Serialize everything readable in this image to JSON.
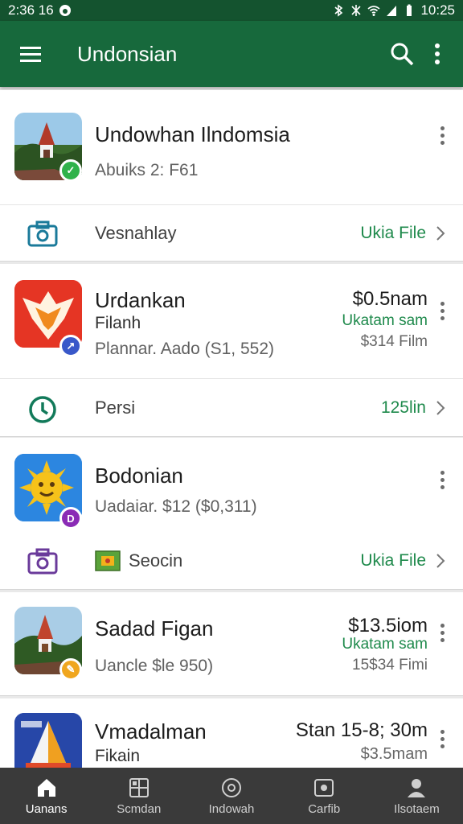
{
  "status": {
    "left_time": "2:36 16",
    "right_time": "10:25"
  },
  "appbar": {
    "title": "Undonsian"
  },
  "cards": [
    {
      "name": "Undowhan Ilndomsia",
      "meta": "Abuiks 2: F61",
      "sub_label": "Vesnahlay",
      "sub_link": "Ukia File"
    },
    {
      "name": "Urdankan",
      "line2": "Filanh",
      "meta": "Plannar. Aado (S1, 552)",
      "price": "$0.5nam",
      "price_green": "Ukatam sam",
      "price_gray": "$314 Film",
      "sub_label": "Persi",
      "sub_link": "125lin"
    },
    {
      "name": "Bodonian",
      "meta": "Uadaiar. $12  ($0,311)",
      "sub_label": "Seocin",
      "sub_link": "Ukia File"
    },
    {
      "name": "Sadad Figan",
      "meta": "Uancle $le 950)",
      "price": "$13.5iom",
      "price_green": "Ukatam sam",
      "price_gray": "15$34 Fimi"
    },
    {
      "name": "Vmadalman",
      "line2": "Fikain",
      "price": "Stan 15-8; 30m",
      "price_gray": "$3.5mam"
    }
  ],
  "nav": [
    {
      "label": "Uanans",
      "icon": "home-icon"
    },
    {
      "label": "Scmdan",
      "icon": "grid-icon"
    },
    {
      "label": "Indowah",
      "icon": "disc-icon"
    },
    {
      "label": "Carfib",
      "icon": "media-icon"
    },
    {
      "label": "Ilsotaem",
      "icon": "person-icon"
    }
  ],
  "colors": {
    "appbar": "#17693c",
    "statusbar": "#14532f",
    "accent_green": "#1f8a4c",
    "nav_bg": "#3a3a3a"
  }
}
